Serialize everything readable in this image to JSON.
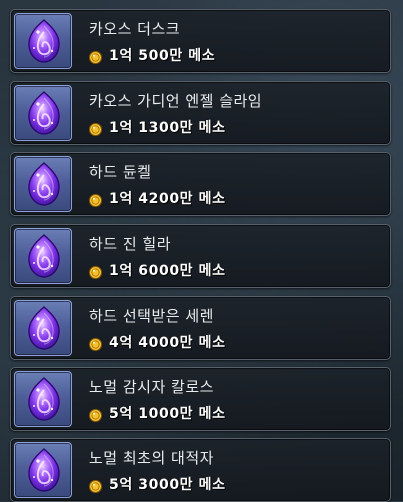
{
  "colors": {
    "panel_border": "#56616b",
    "icon_bg": "#4d5f96",
    "crystal": "#8a3cf0",
    "coin": "#f2c12e",
    "name_text": "#e9ecef",
    "price_text": "#ffffff"
  },
  "items": [
    {
      "name": "카오스 더스크",
      "price": "1억 500만 메소",
      "icon": "purple-crystal-icon"
    },
    {
      "name": "카오스 가디언 엔젤 슬라임",
      "price": "1억 1300만 메소",
      "icon": "purple-crystal-icon"
    },
    {
      "name": "하드 듄켈",
      "price": "1억 4200만 메소",
      "icon": "purple-crystal-icon"
    },
    {
      "name": "하드 진 힐라",
      "price": "1억 6000만 메소",
      "icon": "purple-crystal-icon"
    },
    {
      "name": "하드 선택받은 세렌",
      "price": "4억 4000만 메소",
      "icon": "purple-crystal-icon"
    },
    {
      "name": "노멀 감시자 칼로스",
      "price": "5억 1000만 메소",
      "icon": "purple-crystal-icon"
    },
    {
      "name": "노멀 최초의 대적자",
      "price": "5억 3000만 메소",
      "icon": "purple-crystal-icon"
    }
  ]
}
